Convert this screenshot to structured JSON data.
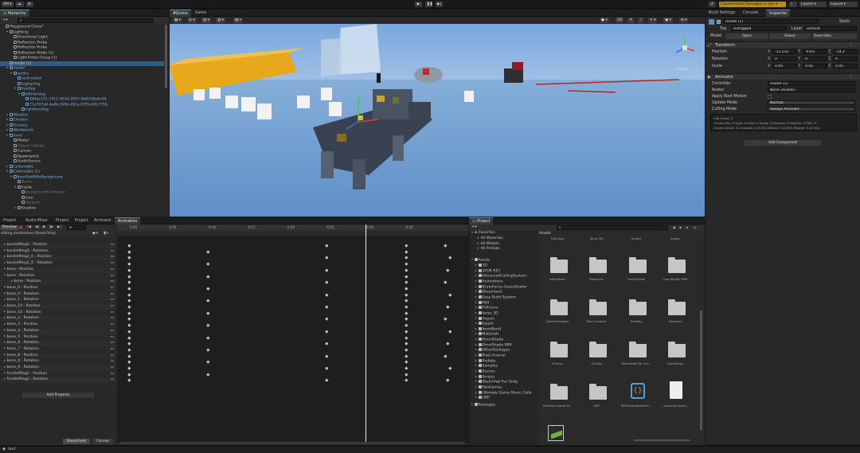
{
  "topbar": {
    "account": "AM",
    "experimental": "Experimental Packages In Use",
    "layers": "Layers",
    "layout": "Layout"
  },
  "hierarchy": {
    "tab": "Hierarchy",
    "rows": [
      {
        "label": "Playground Clone*",
        "indent": 0,
        "kind": "scene"
      },
      {
        "label": "Lighting",
        "indent": 1,
        "kind": "open"
      },
      {
        "label": "Directional Light",
        "indent": 2
      },
      {
        "label": "Reflection Probe",
        "indent": 2
      },
      {
        "label": "Reflection Probe",
        "indent": 2
      },
      {
        "label": "Reflection Probe (1)",
        "indent": 2
      },
      {
        "label": "Light Probe Group (1)",
        "indent": 2
      },
      {
        "label": "model (1)",
        "indent": 1,
        "selected": true
      },
      {
        "label": "model",
        "indent": 1,
        "kind": "open",
        "blue": true
      },
      {
        "label": "sentry",
        "indent": 2,
        "kind": "open",
        "blue": true
      },
      {
        "label": "sentryskull",
        "indent": 3,
        "blue": true
      },
      {
        "label": "legtoprleg",
        "indent": 3,
        "blue": true
      },
      {
        "label": "frontleg",
        "indent": 3,
        "kind": "open",
        "blue": true
      },
      {
        "label": "leftfrontleg",
        "indent": 4,
        "kind": "open",
        "blue": true
      },
      {
        "label": "484ac151-1411-952d-2957-9a8438a4e49",
        "indent": 5,
        "blue": true
      },
      {
        "label": "71e707e9-4a8b-593b-45ca-97f3c43b7756",
        "indent": 5,
        "blue": true
      },
      {
        "label": "rightfrontleg",
        "indent": 4,
        "blue": true
      },
      {
        "label": "Wooden",
        "indent": 1,
        "kind": "closed",
        "blue": true
      },
      {
        "label": "Chicken",
        "indent": 1,
        "kind": "closed",
        "blue": true
      },
      {
        "label": "Furnace",
        "indent": 1,
        "kind": "closed",
        "blue": true
      },
      {
        "label": "Workbench",
        "indent": 1,
        "kind": "closed",
        "blue": true
      },
      {
        "label": "Anvil",
        "indent": 1,
        "kind": "open",
        "blue": true
      },
      {
        "label": "Model",
        "indent": 2
      },
      {
        "label": "Object Collider",
        "indent": 2,
        "dim": true
      },
      {
        "label": "Canvas",
        "indent": 2
      },
      {
        "label": "Spawnpoint",
        "indent": 2
      },
      {
        "label": "AudioSource",
        "indent": 2
      },
      {
        "label": "Collectable",
        "indent": 1,
        "kind": "closed",
        "blue": true
      },
      {
        "label": "Collectable (1)",
        "indent": 1,
        "kind": "open",
        "blue": true
      },
      {
        "label": "ItemSlotWithBackground",
        "indent": 2,
        "kind": "open",
        "blue": true
      },
      {
        "label": "Name",
        "indent": 3,
        "dim": true
      },
      {
        "label": "Inside",
        "indent": 3,
        "kind": "open"
      },
      {
        "label": "BackgroundContainer",
        "indent": 4,
        "dim": true
      },
      {
        "label": "Icon",
        "indent": 4
      },
      {
        "label": "Amount",
        "indent": 4,
        "dim": true
      },
      {
        "label": "Shadow",
        "indent": 3,
        "kind": "closed"
      }
    ]
  },
  "scene": {
    "tabs": [
      "Scene",
      "Game"
    ],
    "persp": "<Persp",
    "mode2d": "2D"
  },
  "inspector": {
    "tabs": [
      "Build Settings",
      "Console",
      "Inspector"
    ],
    "object_name": "model (1)",
    "static": "Static",
    "tag_label": "Tag",
    "tag_value": "Untagged",
    "layer_label": "Layer",
    "layer_value": "Default",
    "model_label": "Model",
    "model_btns": [
      "Open",
      "Select",
      "Overrides"
    ],
    "transform": "Transform",
    "position": {
      "label": "Position",
      "x": "-11.231",
      "y": "-0.03",
      "z": "-14.2"
    },
    "rotation": {
      "label": "Rotation",
      "x": "0",
      "y": "0",
      "z": "0"
    },
    "scale": {
      "label": "Scale",
      "x": "0.05",
      "y": "0.05",
      "z": "0.05"
    },
    "animator": "Animator",
    "controller": {
      "label": "Controller",
      "value": "model (1)"
    },
    "avatar": {
      "label": "Avatar",
      "value": "None (Avatar)"
    },
    "apply_root": "Apply Root Motion",
    "update_mode": {
      "label": "Update Mode",
      "value": "Normal"
    },
    "culling_mode": {
      "label": "Culling Mode",
      "value": "Always Animate"
    },
    "info": [
      "Clip Count: 0",
      "Curves Pos: 0 Quat: 0 Euler: 0 Scale: 0 Muscles: 0 Generic: 0 PPtr: 0",
      "Curves Count: 0 Constant: 0 (0.0%) Dense: 0 (0.0%) Stream: 0 (0.0%)"
    ],
    "add_component": "Add Component"
  },
  "bottom_left": {
    "tabs": [
      "Project",
      "Audio Mixer",
      "Project",
      "Project",
      "Animator",
      "Animation"
    ],
    "preview": "Preview",
    "clip_name": "sitting.modelview (Read-Only)",
    "frame": "0",
    "properties": [
      "backleftleg2 : Position",
      "backleftleg2 : Rotation",
      "backleftleg2_0 : Position",
      "backleftleg2_0 : Rotation",
      "bone : Position",
      "bone : Rotation",
      "bone : Position",
      "bone_0 : Position",
      "bone_0 : Rotation",
      "bone_1 : Rotation",
      "bone_10 : Position",
      "bone_10 : Rotation",
      "bone_2 : Rotation",
      "bone_4 : Position",
      "bone_4 : Rotation",
      "bone_5 : Position",
      "bone_6 : Rotation",
      "bone_7 : Rotation",
      "bone_8 : Position",
      "bone_8 : Rotation",
      "bone_9 : Rotation",
      "frontleftleg2 : Position",
      "frontleftleg2 : Rotation"
    ],
    "add_property": "Add Property",
    "timeline_ticks": [
      "0:00",
      "0:05",
      "0:10",
      "0:15",
      "0:20",
      "0:25",
      "0:30",
      "0:35"
    ],
    "dopesheet": "Dopesheet",
    "curves": "Curves"
  },
  "project": {
    "tab": "Project",
    "favorites": "Favorites",
    "fav_items": [
      "All Materials",
      "All Models",
      "All Prefabs"
    ],
    "assets_label": "Assets",
    "tree": [
      "3D",
      "3FOR REC",
      "AdvancedCullingSystem",
      "Animations",
      "BruteForce-GrassShader",
      "Dreamteck",
      "Easy Build System",
      "FBX",
      "Follicons",
      "Ienos 3D",
      "Import",
      "Inputs",
      "ItemWorld",
      "Materials",
      "OmniShade",
      "OmniShade PBR",
      "OtherPackages",
      "Pixel Arsenal",
      "Prefabs",
      "Samples",
      "Scenes",
      "Scripts",
      "Sketchfab For Unity",
      "TwoGames",
      "Ultimate Game Music Colle",
      "URP"
    ],
    "packages": "Packages",
    "breadcrumb": "Assets",
    "top_row": [
      "Follicons",
      "Ienos 3D",
      "Import",
      "Inputs"
    ],
    "grid": [
      "ItemWorld",
      "Materials",
      "OmniShade",
      "OmniShade PBR",
      "OtherPackages",
      "Pixel Arsenal",
      "Prefabs",
      "Samples",
      "Scenes",
      "Scripts",
      "Sketchfab For Uni...",
      "TwoGames",
      "Ultimate Game M...",
      "URP",
      "SDShaderNodePro...",
      "...www.amaysea..."
    ]
  },
  "status": {
    "text": "Sort"
  },
  "colors": {
    "accent": "#4d8fd6",
    "selected": "#2c5d87",
    "warning": "#b88b1f",
    "panel": "#282828"
  }
}
